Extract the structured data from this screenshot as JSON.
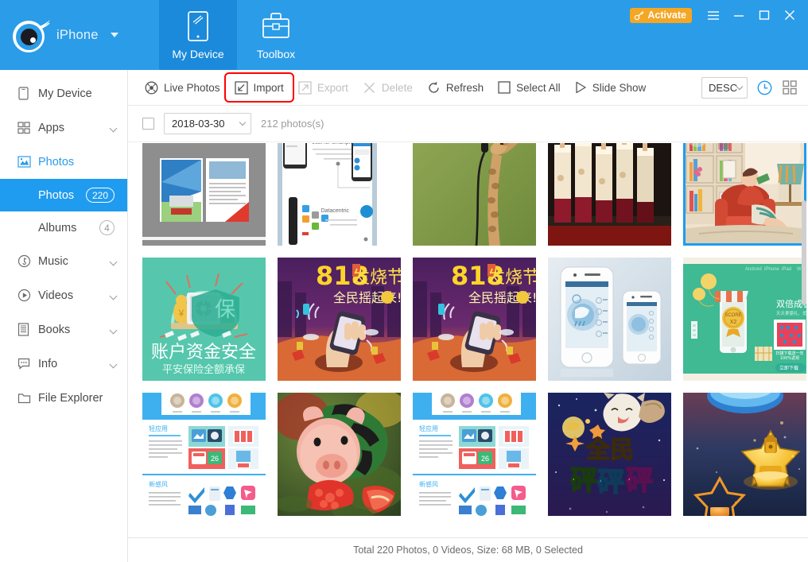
{
  "header": {
    "device_name": "iPhone",
    "logo_icon": "eye-comet-logo",
    "dropdown_icon": "chevron-down-icon",
    "tabs": [
      {
        "label": "My Device",
        "icon": "tablet-icon",
        "active": true
      },
      {
        "label": "Toolbox",
        "icon": "briefcase-icon",
        "active": false
      }
    ],
    "activate_label": "Activate",
    "activate_icon": "key-icon",
    "activate_color": "#f5a623",
    "window_buttons": [
      "menu-icon",
      "minimize-icon",
      "maximize-icon",
      "close-icon"
    ],
    "bg_color": "#2b9ce8",
    "active_tab_color": "#1b8ada"
  },
  "sidebar": {
    "items": [
      {
        "label": "My Device",
        "icon": "device-icon",
        "expandable": false,
        "highlighted": false
      },
      {
        "label": "Apps",
        "icon": "apps-grid-icon",
        "expandable": true,
        "highlighted": false
      },
      {
        "label": "Photos",
        "icon": "photo-icon",
        "expandable": false,
        "highlighted": true
      },
      {
        "label": "Music",
        "icon": "music-disc-icon",
        "expandable": true,
        "highlighted": false
      },
      {
        "label": "Videos",
        "icon": "video-play-icon",
        "expandable": true,
        "highlighted": false
      },
      {
        "label": "Books",
        "icon": "books-icon",
        "expandable": true,
        "highlighted": false
      },
      {
        "label": "Info",
        "icon": "info-message-icon",
        "expandable": true,
        "highlighted": false
      },
      {
        "label": "File Explorer",
        "icon": "folder-icon",
        "expandable": false,
        "highlighted": false
      }
    ],
    "sub_items": [
      {
        "label": "Photos",
        "count": "220",
        "active": true
      },
      {
        "label": "Albums",
        "count": "4",
        "active": false
      }
    ],
    "active_color": "#1f9bf0"
  },
  "toolbar": {
    "buttons": [
      {
        "label": "Live Photos",
        "icon": "live-photos-icon",
        "disabled": false,
        "highlighted": false
      },
      {
        "label": "Import",
        "icon": "import-icon",
        "disabled": false,
        "highlighted": true
      },
      {
        "label": "Export",
        "icon": "export-icon",
        "disabled": true,
        "highlighted": false
      },
      {
        "label": "Delete",
        "icon": "delete-x-icon",
        "disabled": true,
        "highlighted": false
      },
      {
        "label": "Refresh",
        "icon": "refresh-icon",
        "disabled": false,
        "highlighted": false
      },
      {
        "label": "Select All",
        "icon": "checkbox-icon",
        "disabled": false,
        "highlighted": false
      },
      {
        "label": "Slide Show",
        "icon": "play-triangle-icon",
        "disabled": false,
        "highlighted": false
      }
    ],
    "sort_value": "DESC",
    "sort_chevron_icon": "chevron-down-icon",
    "view_time_icon": "clock-icon",
    "view_grid_icon": "grid-view-icon",
    "highlight_color": "#ff0000",
    "active_view_color": "#1f9bf0"
  },
  "filter": {
    "select_all_checkbox": "unchecked",
    "date_value": "2018-03-30",
    "date_chevron_icon": "chevron-down-icon",
    "photo_count_label": "212 photos(s)"
  },
  "grid": {
    "rows": [
      [
        {
          "name": "brochure-mockup",
          "selected": false,
          "partial_top": true
        },
        {
          "name": "smartphone-infographic",
          "selected": false,
          "partial_top": true
        },
        {
          "name": "giraffe-headphones",
          "selected": false,
          "partial_top": true
        },
        {
          "name": "dessert-parfait-shots",
          "selected": false,
          "partial_top": true
        },
        {
          "name": "woman-reading-armchair",
          "selected": true,
          "partial_top": true
        }
      ],
      [
        {
          "name": "account-fund-security-green",
          "selected": false,
          "partial_top": false
        },
        {
          "name": "818-festival-purple-a",
          "selected": false,
          "partial_top": false
        },
        {
          "name": "818-festival-purple-b",
          "selected": false,
          "partial_top": false
        },
        {
          "name": "iphone-weather-app",
          "selected": false,
          "partial_top": false
        },
        {
          "name": "green-promo-qrcode",
          "selected": false,
          "partial_top": false
        }
      ],
      [
        {
          "name": "blue-app-feature-a",
          "selected": false,
          "partial_top": false
        },
        {
          "name": "pink-pig-toy",
          "selected": false,
          "partial_top": false
        },
        {
          "name": "blue-app-feature-b",
          "selected": false,
          "partial_top": false
        },
        {
          "name": "cat-game-banner",
          "selected": false,
          "partial_top": false
        },
        {
          "name": "gold-star-trophy",
          "selected": false,
          "partial_top": false
        }
      ]
    ],
    "selection_color": "#1f9bf0",
    "check_icon": "checkmark-icon"
  },
  "status": {
    "text": "Total 220 Photos, 0 Videos, Size: 68 MB, 0 Selected"
  }
}
